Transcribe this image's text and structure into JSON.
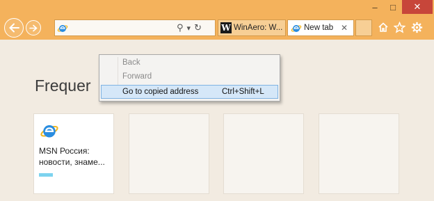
{
  "window": {
    "minimize_glyph": "–",
    "maximize_glyph": "□",
    "close_glyph": "✕"
  },
  "address_bar": {
    "value": "",
    "search_glyph": "⚲",
    "dropdown_glyph": "▾",
    "refresh_glyph": "↻"
  },
  "tabs": [
    {
      "label": "WinAero: W...",
      "icon": "winaero-w-icon",
      "logo_letter": "W"
    },
    {
      "label": "New tab",
      "icon": "ie-icon",
      "close_glyph": "✕"
    }
  ],
  "toolbar": {
    "home_icon": "home-icon",
    "favorites_icon": "star-icon",
    "tools_icon": "gear-icon"
  },
  "page": {
    "heading": "Frequer",
    "tiles": [
      {
        "title": "MSN Россия: новости, знаме...",
        "icon": "ie-icon",
        "bar_color": "#7dd3ef"
      },
      {
        "title": ""
      },
      {
        "title": ""
      },
      {
        "title": ""
      }
    ]
  },
  "context_menu": {
    "items": [
      {
        "label": "Back",
        "enabled": false,
        "shortcut": ""
      },
      {
        "label": "Forward",
        "enabled": false,
        "shortcut": ""
      },
      {
        "label": "Go to copied address",
        "enabled": true,
        "highlighted": true,
        "shortcut": "Ctrl+Shift+L"
      }
    ]
  },
  "colors": {
    "titlebar": "#f4b25c",
    "close_button": "#c7463a",
    "page_background": "#f2ebe1",
    "menu_highlight": "#d5e7f8"
  }
}
